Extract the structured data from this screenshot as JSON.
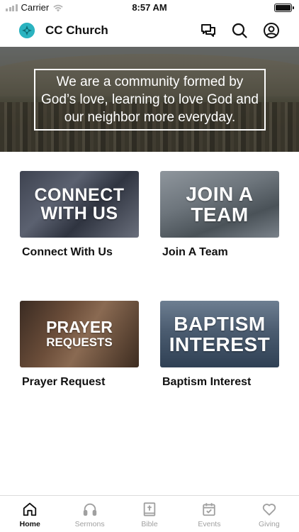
{
  "status_bar": {
    "carrier": "Carrier",
    "time": "8:57 AM"
  },
  "header": {
    "title": "CC Church",
    "icons": [
      "chat-icon",
      "search-icon",
      "profile-icon"
    ]
  },
  "hero": {
    "text": "We are a community formed by God’s love, learning to love God and our neighbor more everyday."
  },
  "cards": [
    {
      "image_line1": "CONNECT",
      "image_line2": "WITH US",
      "caption": "Connect With Us"
    },
    {
      "image_line1": "JOIN A",
      "image_line2": "TEAM",
      "caption": "Join A Team"
    },
    {
      "image_line1": "PRAYER",
      "image_line2": "REQUESTS",
      "caption": "Prayer Request"
    },
    {
      "image_line1": "BAPTISM",
      "image_line2": "INTEREST",
      "caption": "Baptism Interest"
    }
  ],
  "tabs": [
    {
      "label": "Home",
      "icon": "home-icon",
      "active": true
    },
    {
      "label": "Sermons",
      "icon": "headphones-icon",
      "active": false
    },
    {
      "label": "Bible",
      "icon": "bible-icon",
      "active": false
    },
    {
      "label": "Events",
      "icon": "calendar-icon",
      "active": false
    },
    {
      "label": "Giving",
      "icon": "heart-icon",
      "active": false
    }
  ],
  "colors": {
    "brand": "#2bb3c0",
    "tab_active": "#111111",
    "tab_inactive": "#a0a0a0"
  }
}
